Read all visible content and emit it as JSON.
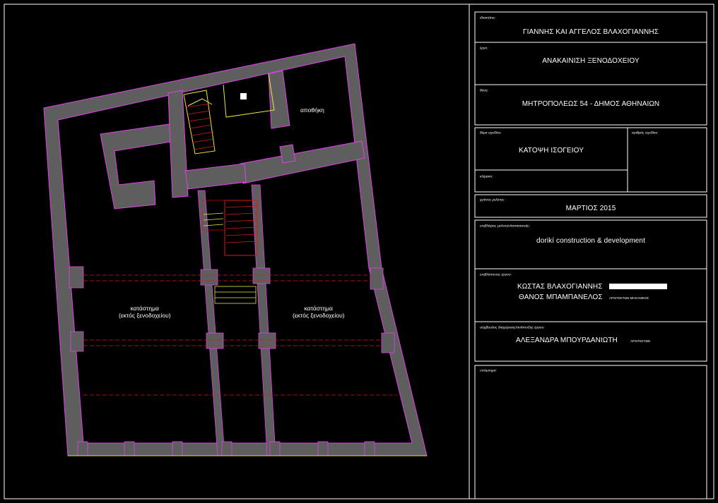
{
  "title_block": {
    "owners_label": "ιδιοκτήτες:",
    "owners": "ΓΙΑΝΝΗΣ ΚΑΙ ΑΓΓΕΛΟΣ ΒΛΑΧΟΓΙΑΝΝΗΣ",
    "project_label": "έργο:",
    "project": "ΑΝΑΚΑΙΝΙΣΗ ΞΕΝΟΔΟΧΕΙΟΥ",
    "location_label": "θέση:",
    "location": "ΜΗΤΡΟΠΟΛΕΩΣ 54 - ΔΗΜΟΣ ΑΘΗΝΑΙΩΝ",
    "drawing_label": "θέμα σχεδίου:",
    "drawing": "ΚΑΤΟΨΗ ΙΣΟΓΕΙΟΥ",
    "drawing_no_label": "αριθμός σχεδίου:",
    "scale_label": "κλίμακα:",
    "date_label": "χρόνος μελέτης:",
    "date": "ΜΑΡΤΙΟΣ 2015",
    "company_label": "επιβλέψεις μελετών/κατασκευής:",
    "company": "dorikí construction & development",
    "engineers_label": "επιβλέποντες έργου:",
    "engineer_1": "ΚΩΣΤΑΣ ΒΛΑΧΟΓΙΑΝΝΗΣ",
    "engineer_2": "ΘΑΝΟΣ ΜΠΑΜΠΑΝΕΛΟΣ",
    "engineer_2_role": "ΑΡΧΙΤΕΚΤΩΝ ΜΗΧΑΝΙΚΟΣ",
    "consultant_label": "σύμβουλος διαχείρισης/ανάπτυξης έργου:",
    "consultant": "ΑΛΕΞΑΝΔΡΑ ΜΠΟΥΡΔΑΝΙΩΤΗ",
    "consultant_role": "ΑΡΧΙΤΕΚΤΩΝ",
    "notes_label": "υπόμνημα:"
  },
  "plan": {
    "storage_label": "αποθήκη",
    "shop_left_line1": "κατάστημα",
    "shop_left_line2": "(εκτός ξενοδοχείου)",
    "shop_right_line1": "κατάστημα",
    "shop_right_line2": "(εκτός ξενοδοχείου)"
  },
  "colors": {
    "wall_fill": "#5e5e5e",
    "wall_outline": "#e040e8",
    "stair_red": "#e01818",
    "stair_yellow": "#e8e840",
    "frame": "#ffffff"
  }
}
